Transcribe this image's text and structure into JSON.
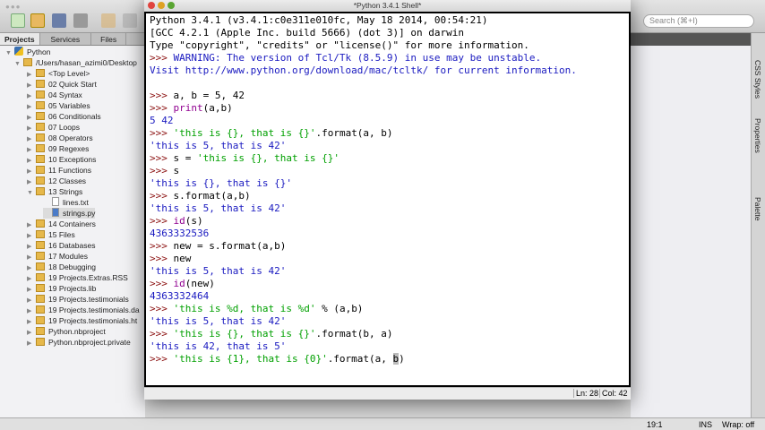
{
  "ide": {
    "tabs": [
      "Projects",
      "Services",
      "Files"
    ],
    "search_placeholder": "Search (⌘+I)",
    "tree": [
      {
        "label": "Python",
        "type": "project",
        "level": 0,
        "open": true
      },
      {
        "label": "/Users/hasan_azimi0/Desktop",
        "type": "root",
        "level": 1,
        "open": true
      },
      {
        "label": "<Top Level>",
        "type": "folder",
        "level": 2
      },
      {
        "label": "02 Quick Start",
        "type": "folder",
        "level": 2
      },
      {
        "label": "04 Syntax",
        "type": "folder",
        "level": 2
      },
      {
        "label": "05 Variables",
        "type": "folder",
        "level": 2
      },
      {
        "label": "06 Conditionals",
        "type": "folder",
        "level": 2
      },
      {
        "label": "07 Loops",
        "type": "folder",
        "level": 2
      },
      {
        "label": "08 Operators",
        "type": "folder",
        "level": 2
      },
      {
        "label": "09 Regexes",
        "type": "folder",
        "level": 2
      },
      {
        "label": "10 Exceptions",
        "type": "folder",
        "level": 2
      },
      {
        "label": "11 Functions",
        "type": "folder",
        "level": 2
      },
      {
        "label": "12 Classes",
        "type": "folder",
        "level": 2
      },
      {
        "label": "13 Strings",
        "type": "folder",
        "level": 2,
        "open": true
      },
      {
        "label": "lines.txt",
        "type": "file",
        "level": 3
      },
      {
        "label": "strings.py",
        "type": "pyfile",
        "level": 3
      },
      {
        "label": "14 Containers",
        "type": "folder",
        "level": 2
      },
      {
        "label": "15 Files",
        "type": "folder",
        "level": 2
      },
      {
        "label": "16 Databases",
        "type": "folder",
        "level": 2
      },
      {
        "label": "17 Modules",
        "type": "folder",
        "level": 2
      },
      {
        "label": "18 Debugging",
        "type": "folder",
        "level": 2
      },
      {
        "label": "19 Projects.Extras.RSS",
        "type": "folder",
        "level": 2
      },
      {
        "label": "19 Projects.lib",
        "type": "folder",
        "level": 2
      },
      {
        "label": "19 Projects.testimonials",
        "type": "folder",
        "level": 2
      },
      {
        "label": "19 Projects.testimonials.da",
        "type": "folder",
        "level": 2
      },
      {
        "label": "19 Projects.testimonials.ht",
        "type": "folder",
        "level": 2
      },
      {
        "label": "Python.nbproject",
        "type": "folder",
        "level": 2
      },
      {
        "label": "Python.nbproject.private",
        "type": "folder",
        "level": 2
      }
    ],
    "side_panels": [
      "CSS Styles",
      "Properties",
      "Palette"
    ],
    "status": {
      "position": "19:1",
      "mode": "INS",
      "wrap": "Wrap: off"
    }
  },
  "shell": {
    "title": "*Python 3.4.1 Shell*",
    "status": {
      "line": "Ln: 28",
      "col": "Col: 42"
    },
    "colors": {
      "prompt": "#8b1010",
      "string": "#00a000",
      "output": "#1a1ac0",
      "builtin": "#900090"
    },
    "lines": [
      [
        [
          "Python 3.4.1 (v3.4.1:c0e311e010fc, May 18 2014, 00:54:21)",
          "n"
        ]
      ],
      [
        [
          "[GCC 4.2.1 (Apple Inc. build 5666) (dot 3)] on darwin",
          "n"
        ]
      ],
      [
        [
          "Type \"copyright\", \"credits\" or \"license()\" for more information.",
          "n"
        ]
      ],
      [
        [
          ">>> ",
          "p"
        ],
        [
          "WARNING: The version of Tcl/Tk (8.5.9) in use may be unstable.",
          "o"
        ]
      ],
      [
        [
          "Visit http://www.python.org/download/mac/tcltk/ for current information.",
          "o"
        ]
      ],
      [],
      [
        [
          ">>> ",
          "p"
        ],
        [
          "a, b = 5, 42",
          "n"
        ]
      ],
      [
        [
          ">>> ",
          "p"
        ],
        [
          "print",
          "b"
        ],
        [
          "(a,b)",
          "n"
        ]
      ],
      [
        [
          "5 42",
          "o"
        ]
      ],
      [
        [
          ">>> ",
          "p"
        ],
        [
          "'this is {}, that is {}'",
          "s"
        ],
        [
          ".format(a, b)",
          "n"
        ]
      ],
      [
        [
          "'this is 5, that is 42'",
          "o"
        ]
      ],
      [
        [
          ">>> ",
          "p"
        ],
        [
          "s = ",
          "n"
        ],
        [
          "'this is {}, that is {}'",
          "s"
        ]
      ],
      [
        [
          ">>> ",
          "p"
        ],
        [
          "s",
          "n"
        ]
      ],
      [
        [
          "'this is {}, that is {}'",
          "o"
        ]
      ],
      [
        [
          ">>> ",
          "p"
        ],
        [
          "s.format(a,b)",
          "n"
        ]
      ],
      [
        [
          "'this is 5, that is 42'",
          "o"
        ]
      ],
      [
        [
          ">>> ",
          "p"
        ],
        [
          "id",
          "b"
        ],
        [
          "(s)",
          "n"
        ]
      ],
      [
        [
          "4363332536",
          "o"
        ]
      ],
      [
        [
          ">>> ",
          "p"
        ],
        [
          "new = s.format(a,b)",
          "n"
        ]
      ],
      [
        [
          ">>> ",
          "p"
        ],
        [
          "new",
          "n"
        ]
      ],
      [
        [
          "'this is 5, that is 42'",
          "o"
        ]
      ],
      [
        [
          ">>> ",
          "p"
        ],
        [
          "id",
          "b"
        ],
        [
          "(new)",
          "n"
        ]
      ],
      [
        [
          "4363332464",
          "o"
        ]
      ],
      [
        [
          ">>> ",
          "p"
        ],
        [
          "'this is %d, that is %d'",
          "s"
        ],
        [
          " % (a,b)",
          "n"
        ]
      ],
      [
        [
          "'this is 5, that is 42'",
          "o"
        ]
      ],
      [
        [
          ">>> ",
          "p"
        ],
        [
          "'this is {}, that is {}'",
          "s"
        ],
        [
          ".format(b, a)",
          "n"
        ]
      ],
      [
        [
          "'this is 42, that is 5'",
          "o"
        ]
      ],
      [
        [
          ">>> ",
          "p"
        ],
        [
          "'this is {1}, that is {0}'",
          "s"
        ],
        [
          ".format(a, ",
          "n"
        ],
        [
          "b",
          "sel"
        ],
        [
          ")",
          "n"
        ]
      ]
    ]
  }
}
